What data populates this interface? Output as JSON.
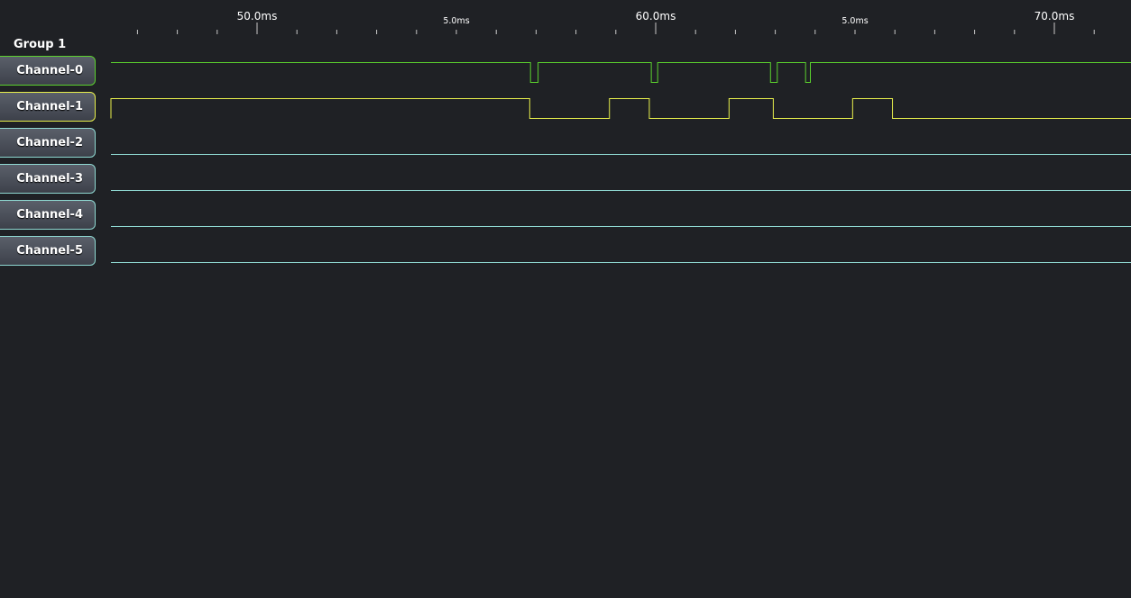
{
  "ruler": {
    "major_ticks": [
      {
        "label": "50.0ms",
        "t": 50.0
      },
      {
        "label": "60.0ms",
        "t": 60.0
      },
      {
        "label": "70.0ms",
        "t": 70.0
      }
    ],
    "sub_labels": [
      {
        "label": "5.0ms",
        "t": 55.0
      },
      {
        "label": "5.0ms",
        "t": 65.0
      }
    ],
    "view_start_ms": 43.66,
    "view_end_ms": 69.24,
    "minor_tick_ms": 1.0
  },
  "group": {
    "label": "Group 1"
  },
  "channels": [
    {
      "label": "Channel-0",
      "color": "#5bd12e",
      "initial": 1,
      "transitions_ms": [
        56.86,
        57.05,
        59.89,
        60.05,
        62.88,
        63.05,
        63.76,
        63.88
      ]
    },
    {
      "label": "Channel-1",
      "color": "#e8f04c",
      "initial": 0,
      "transitions_ms": [
        43.86,
        56.84,
        58.84,
        59.84,
        61.84,
        62.95,
        64.94,
        65.94
      ]
    },
    {
      "label": "Channel-2",
      "color": "#8fd9d2",
      "initial": 0,
      "transitions_ms": []
    },
    {
      "label": "Channel-3",
      "color": "#8fd9d2",
      "initial": 0,
      "transitions_ms": []
    },
    {
      "label": "Channel-4",
      "color": "#8fd9d2",
      "initial": 0,
      "transitions_ms": []
    },
    {
      "label": "Channel-5",
      "color": "#8fd9d2",
      "initial": 0,
      "transitions_ms": []
    }
  ],
  "colors": {
    "background": "#1f2125",
    "ruler_text": "#ffffff",
    "tick": "#c8c8c8"
  }
}
